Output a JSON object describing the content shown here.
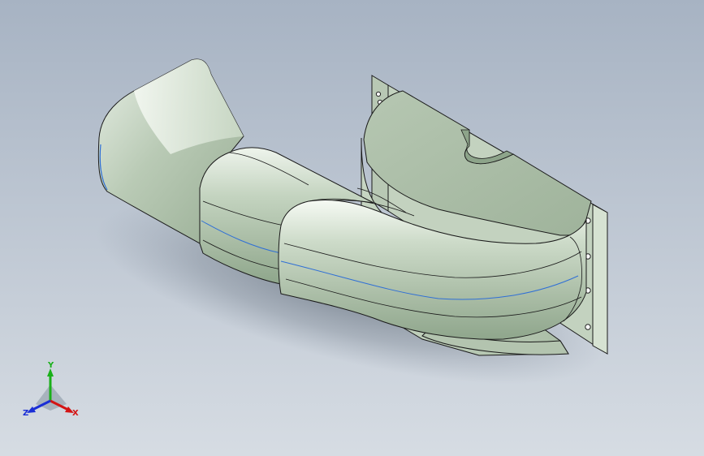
{
  "viewport": {
    "background_top": "#a7b3c3",
    "background_bottom": "#d6dce3"
  },
  "model": {
    "name": "duct-elbow-with-flange",
    "body_color": "#c8d8c4",
    "edge_color": "#1a1a1a",
    "silhouette_highlight_color": "#2f6fd6"
  },
  "triad": {
    "x_label": "X",
    "y_label": "Y",
    "z_label": "Z",
    "x_color": "#d41414",
    "y_color": "#19b019",
    "z_color": "#1a2ed6"
  }
}
